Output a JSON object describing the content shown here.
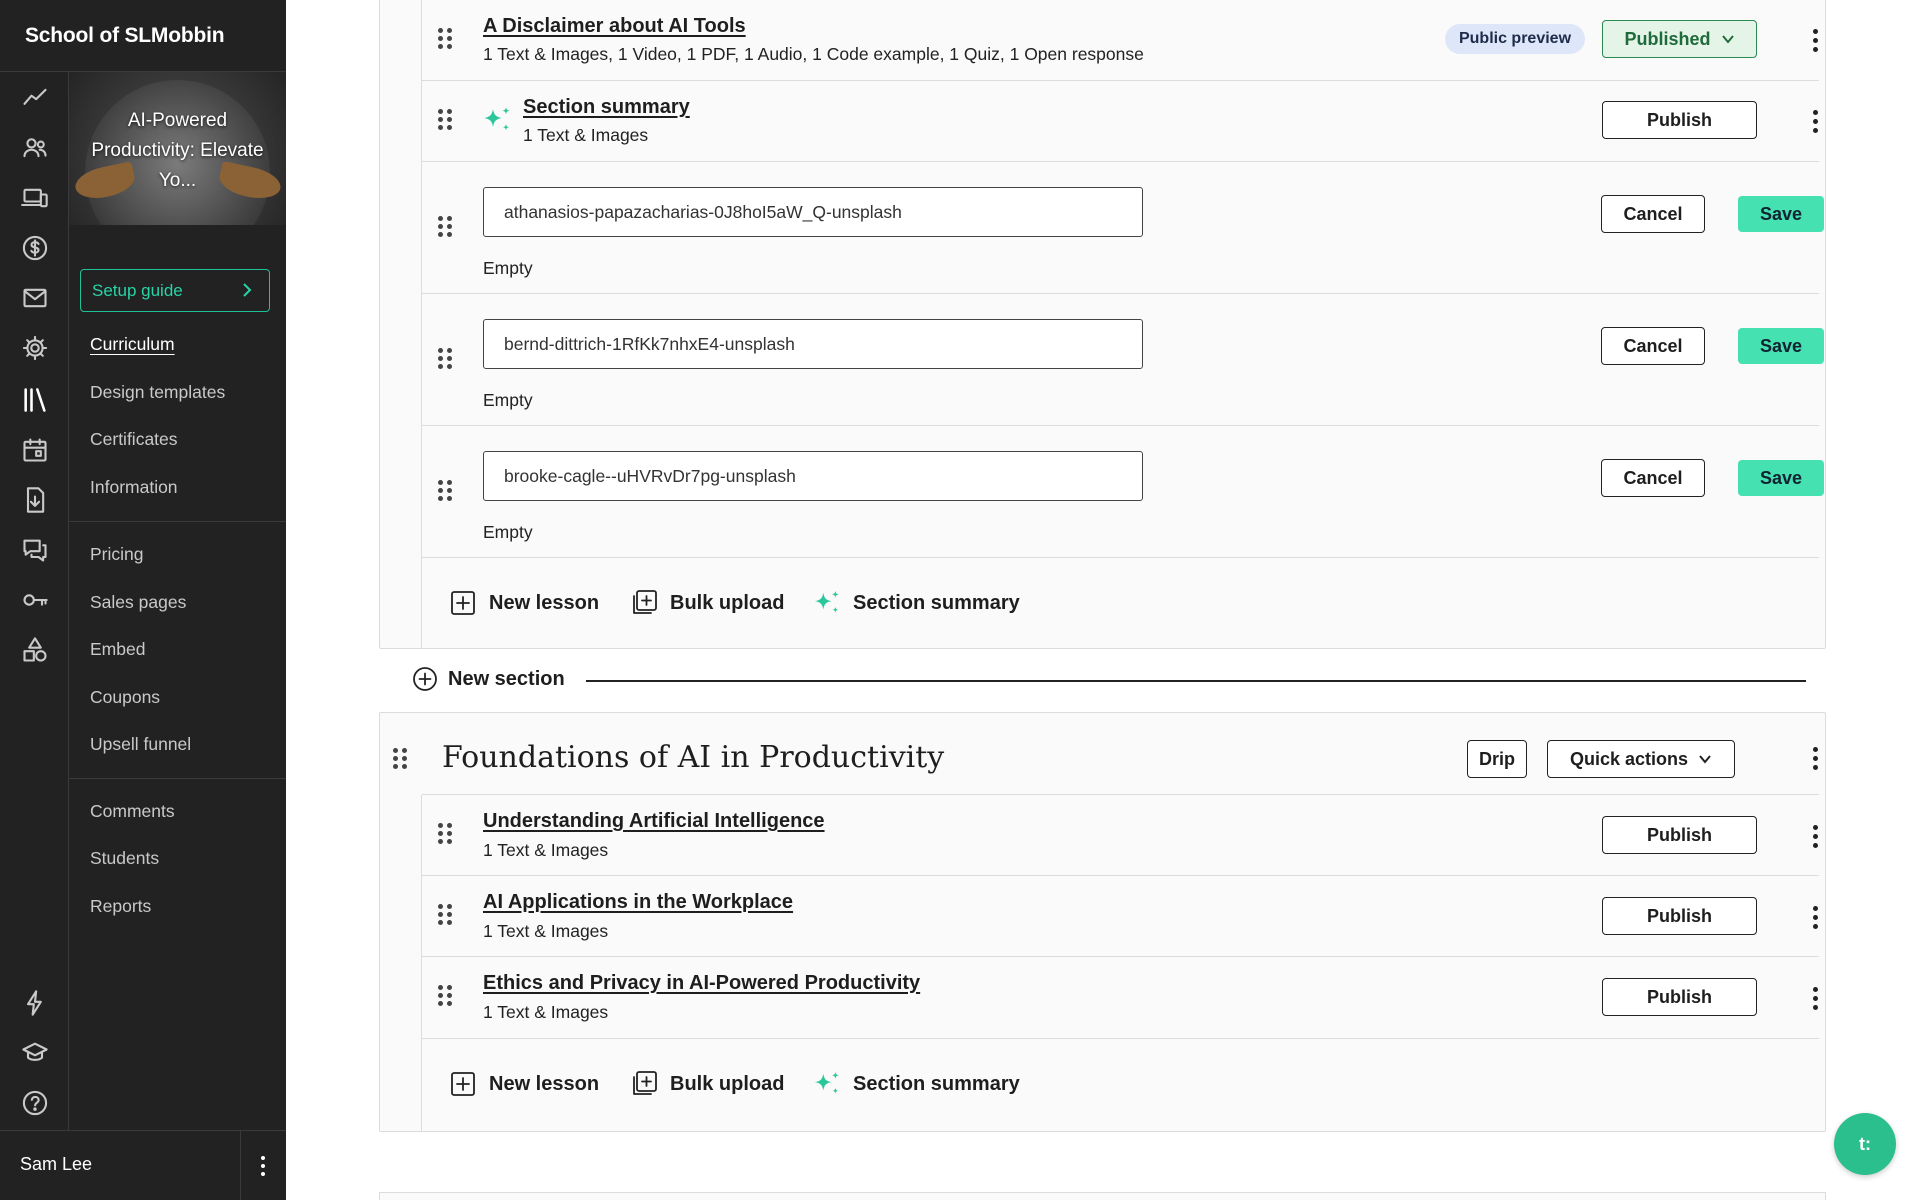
{
  "sidebar": {
    "school_name": "School of SLMobbin",
    "course_title": "AI-Powered Productivity: Elevate Yo...",
    "setup_guide": "Setup guide",
    "rail_icons": [
      "analytics-icon",
      "users-icon",
      "devices-icon",
      "dollar-icon",
      "mail-icon",
      "gear-icon",
      "library-icon",
      "calendar-icon",
      "download-icon",
      "chat-icon",
      "key-icon",
      "shapes-icon",
      "lightning-icon",
      "graduation-cap-icon",
      "help-icon"
    ],
    "groups": [
      [
        "Curriculum",
        "Design templates",
        "Certificates",
        "Information"
      ],
      [
        "Pricing",
        "Sales pages",
        "Embed",
        "Coupons",
        "Upsell funnel"
      ],
      [
        "Comments",
        "Students",
        "Reports"
      ]
    ],
    "user_name": "Sam Lee"
  },
  "section1": {
    "lessons": [
      {
        "title": "A Disclaimer about AI Tools",
        "subtitle": "1 Text & Images, 1 Video, 1 PDF, 1 Audio, 1 Code example, 1 Quiz, 1 Open response",
        "badge": "Public preview",
        "status": "Published"
      },
      {
        "title": "Section summary",
        "subtitle": "1 Text & Images",
        "button": "Publish"
      }
    ],
    "editing_rows": [
      {
        "value": "athanasios-papazacharias-0J8hoI5aW_Q-unsplash",
        "empty": "Empty",
        "cancel": "Cancel",
        "save": "Save"
      },
      {
        "value": "bernd-dittrich-1RfKk7nhxE4-unsplash",
        "empty": "Empty",
        "cancel": "Cancel",
        "save": "Save"
      },
      {
        "value": "brooke-cagle--uHVRvDr7pg-unsplash",
        "empty": "Empty",
        "cancel": "Cancel",
        "save": "Save"
      }
    ],
    "actions": {
      "new_lesson": "New lesson",
      "bulk_upload": "Bulk upload",
      "section_summary": "Section summary"
    }
  },
  "new_section": "New section",
  "section2": {
    "title": "Foundations of AI in Productivity",
    "drip": "Drip",
    "quick_actions": "Quick actions",
    "lessons": [
      {
        "title": "Understanding Artificial Intelligence",
        "subtitle": "1 Text & Images",
        "button": "Publish"
      },
      {
        "title": "AI Applications in the Workplace",
        "subtitle": "1 Text & Images",
        "button": "Publish"
      },
      {
        "title": "Ethics and Privacy in AI-Powered Productivity",
        "subtitle": "1 Text & Images",
        "button": "Publish"
      }
    ],
    "actions": {
      "new_lesson": "New lesson",
      "bulk_upload": "Bulk upload",
      "section_summary": "Section summary"
    }
  },
  "chat": {
    "label": "t:"
  },
  "colors": {
    "accent": "#45e1b0",
    "sidebar_bg": "#222222",
    "published": "#1f6b3b"
  }
}
